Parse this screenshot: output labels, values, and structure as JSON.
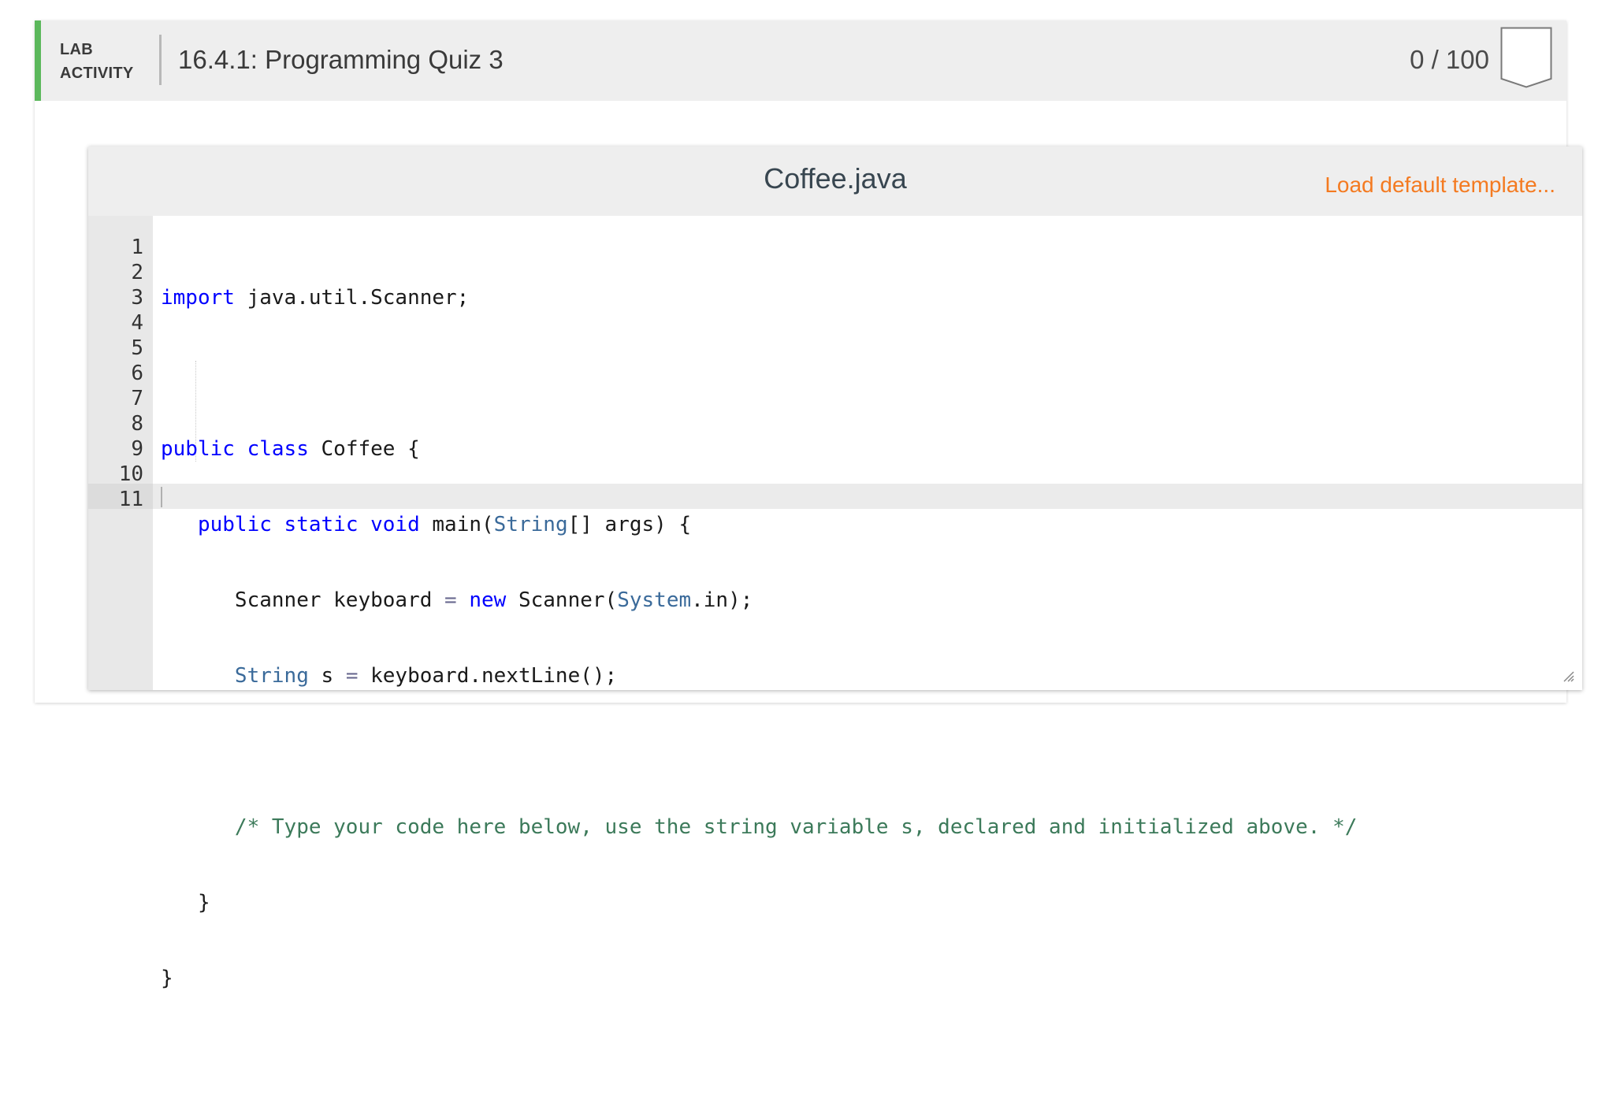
{
  "header": {
    "lab_line1": "LAB",
    "lab_line2": "ACTIVITY",
    "title": "16.4.1: Programming Quiz 3",
    "score": "0 / 100"
  },
  "editor": {
    "file_name": "Coffee.java",
    "load_template_label": "Load default template...",
    "line_numbers": [
      "1",
      "2",
      "3",
      "4",
      "5",
      "6",
      "7",
      "8",
      "9",
      "10",
      "11"
    ],
    "code": {
      "l1_kw": "import",
      "l1_rest": " java.util.Scanner;",
      "l3_kw1": "public",
      "l3_kw2": "class",
      "l3_rest": " Coffee {",
      "l4_kw1": "public",
      "l4_kw2": "static",
      "l4_kw3": "void",
      "l4_mid": " main(",
      "l4_type": "String",
      "l4_rest": "[] args) {",
      "l5_a": "Scanner keyboard ",
      "l5_eq": "=",
      "l5_kw": "new",
      "l5_b": " Scanner(",
      "l5_type": "System",
      "l5_c": ".in);",
      "l6_type": "String",
      "l6_a": " s ",
      "l6_eq": "=",
      "l6_b": " keyboard.nextLine();",
      "l8_comment": "/* Type your code here below, use the string variable s, declared and initialized above. */",
      "l9": "}",
      "l10": "}"
    }
  }
}
